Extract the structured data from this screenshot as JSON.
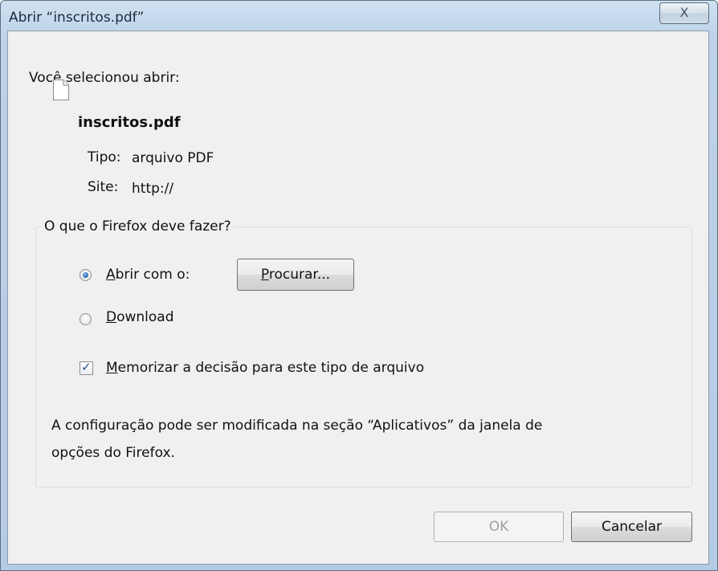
{
  "window": {
    "title": "Abrir “inscritos.pdf”",
    "close_glyph": "X"
  },
  "intro": {
    "label": "Você selecionou abrir:"
  },
  "file": {
    "icon": "document-icon",
    "name": "inscritos.pdf",
    "type_label": "Tipo:",
    "type_value": "arquivo PDF",
    "site_label": "Site:",
    "site_value": "http://"
  },
  "action_group": {
    "legend": "O que o Firefox deve fazer?",
    "open_with": {
      "prefix": "A",
      "rest": "brir com o:",
      "selected": true
    },
    "browse_button": {
      "prefix": "P",
      "rest": "rocurar..."
    },
    "download": {
      "prefix": "D",
      "rest": "ownload",
      "selected": false
    },
    "remember": {
      "prefix": "M",
      "rest": "emorizar a decisão para este tipo de arquivo",
      "checked": true
    },
    "note_line1": "A configuração pode ser modificada na seção “Aplicativos” da janela de",
    "note_line2": "opções do Firefox."
  },
  "buttons": {
    "ok": "OK",
    "cancel": "Cancelar"
  }
}
